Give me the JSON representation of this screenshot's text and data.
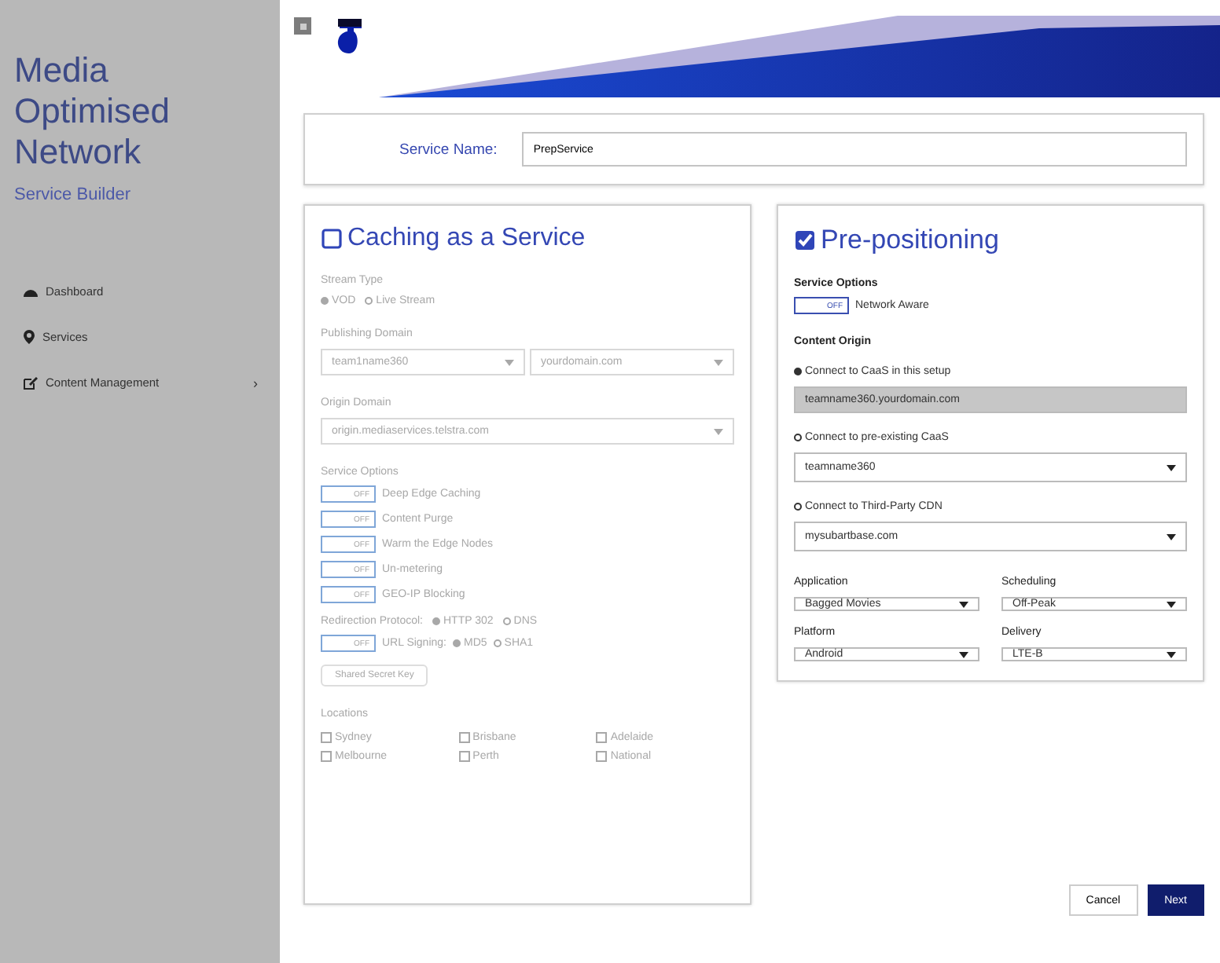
{
  "sidebar": {
    "title": [
      "Media",
      "Optimised",
      "Network"
    ],
    "subtitle": "Service Builder",
    "items": [
      {
        "label": "Dashboard"
      },
      {
        "label": "Services"
      },
      {
        "label": "Content Management",
        "chevron": "›"
      }
    ]
  },
  "service_name": {
    "label": "Service Name:",
    "value": "PrepService"
  },
  "cards": [
    {
      "title": "Caching as a Service",
      "checked": false,
      "items": [
        {
          "kind": "label",
          "text": "Stream Type"
        },
        {
          "kind": "radios",
          "options": [
            {
              "label": "VOD",
              "selected": true
            },
            {
              "label": "Live Stream",
              "selected": false
            }
          ]
        },
        {
          "kind": "label",
          "text": "Publishing Domain"
        },
        {
          "kind": "selects",
          "values": [
            "team1name360",
            "yourdomain.com"
          ]
        },
        {
          "kind": "label",
          "text": "Origin Domain"
        },
        {
          "kind": "select",
          "value": "origin.mediaservices.telstra.com"
        },
        {
          "kind": "label",
          "text": "Service Options"
        },
        {
          "kind": "toggle",
          "on": false,
          "state_label": "OFF",
          "label": "Deep Edge Caching"
        },
        {
          "kind": "toggle",
          "on": false,
          "state_label": "OFF",
          "label": "Content Purge"
        },
        {
          "kind": "toggle",
          "on": false,
          "state_label": "OFF",
          "label": "Warm the Edge Nodes"
        },
        {
          "kind": "toggle",
          "on": false,
          "state_label": "OFF",
          "label": "Un-metering"
        },
        {
          "kind": "toggle",
          "on": false,
          "state_label": "OFF",
          "label": "GEO-IP Blocking"
        },
        {
          "kind": "radios",
          "label": "Redirection Protocol:",
          "options": [
            {
              "label": "HTTP 302",
              "selected": true
            },
            {
              "label": "DNS",
              "selected": false
            }
          ]
        },
        {
          "kind": "toggle",
          "on": false,
          "state_label": "OFF",
          "label": "URL Signing:",
          "options": [
            {
              "label": "MD5",
              "selected": true
            },
            {
              "label": "SHA1",
              "selected": false
            }
          ]
        },
        {
          "kind": "button",
          "text": "Shared Secret Key"
        },
        {
          "kind": "label",
          "text": "Locations"
        },
        {
          "kind": "checkgrid",
          "options": [
            {
              "label": "Sydney",
              "checked": false
            },
            {
              "label": "Brisbane",
              "checked": false
            },
            {
              "label": "Adelaide",
              "checked": false
            },
            {
              "label": "Melbourne",
              "checked": false
            },
            {
              "label": "Perth",
              "checked": false
            },
            {
              "label": "National",
              "checked": false
            }
          ]
        }
      ]
    },
    {
      "title": "Pre-positioning",
      "checked": true,
      "items": [
        {
          "kind": "label",
          "text": "Service Options"
        },
        {
          "kind": "toggle",
          "on": false,
          "state_label": "OFF",
          "label": "Network Aware"
        },
        {
          "kind": "label",
          "text": "Content Origin"
        },
        {
          "kind": "radio",
          "label": "Connect to CaaS in this setup",
          "selected": true
        },
        {
          "kind": "field",
          "value": "teamname360.yourdomain.com",
          "readonly": true
        },
        {
          "kind": "radio",
          "label": "Connect to pre-existing CaaS",
          "selected": false
        },
        {
          "kind": "select",
          "value": "teamname360"
        },
        {
          "kind": "radio",
          "label": "Connect to Third-Party CDN",
          "selected": false
        },
        {
          "kind": "select",
          "value": "mysubartbase.com"
        },
        {
          "kind": "pair",
          "fields": [
            {
              "label": "Application",
              "value": "Bagged Movies"
            },
            {
              "label": "Scheduling",
              "value": "Off-Peak"
            }
          ]
        },
        {
          "kind": "pair",
          "fields": [
            {
              "label": "Platform",
              "value": "Android"
            },
            {
              "label": "Delivery",
              "value": "LTE-B"
            }
          ]
        }
      ]
    }
  ],
  "buttons": [
    {
      "label": "Cancel",
      "kind": "secondary"
    },
    {
      "label": "Next",
      "kind": "primary"
    }
  ]
}
